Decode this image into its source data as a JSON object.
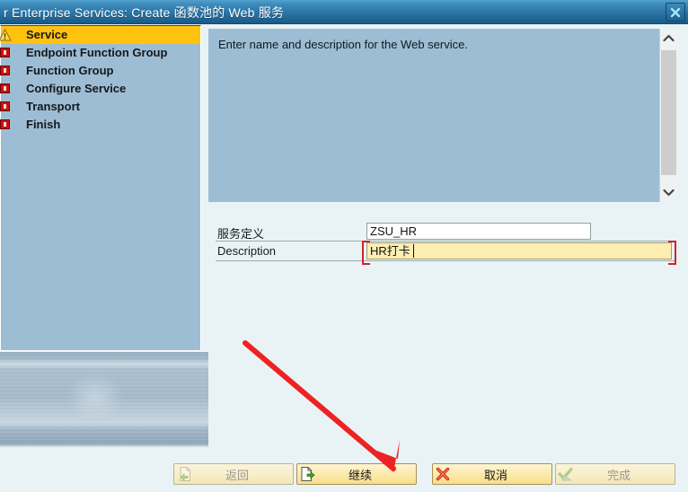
{
  "window": {
    "title": "r Enterprise Services: Create 函数池的 Web 服务",
    "close_icon": "close-icon",
    "titlebar_color": "#2b74a5"
  },
  "roadmap": {
    "steps": [
      {
        "label": "Service",
        "icon": "warning-triangle-icon",
        "selected": true
      },
      {
        "label": "Endpoint Function Group",
        "icon": "red-square-icon",
        "selected": false
      },
      {
        "label": "Function Group",
        "icon": "red-square-icon",
        "selected": false
      },
      {
        "label": "Configure Service",
        "icon": "red-square-icon",
        "selected": false
      },
      {
        "label": "Transport",
        "icon": "red-square-icon",
        "selected": false
      },
      {
        "label": "Finish",
        "icon": "red-square-icon",
        "selected": false
      }
    ],
    "selected_color": "#ffc20e",
    "panel_color": "#9dbdd4"
  },
  "instructions": {
    "text": "Enter name and description for the Web service.",
    "scrollbar": {
      "up_icon": "chevron-up-icon",
      "down_icon": "chevron-down-icon"
    }
  },
  "form": {
    "service_definition": {
      "label": "服务定义",
      "value": "ZSU_HR",
      "placeholder": ""
    },
    "description": {
      "label": "Description",
      "value": "HR打卡",
      "placeholder": "",
      "focused": true,
      "background": "#fdeeb2",
      "focus_marker_color": "#d2232a"
    }
  },
  "footer": {
    "buttons": [
      {
        "id": "back",
        "label": "返回",
        "icon": "page-back-arrow-icon",
        "enabled": false
      },
      {
        "id": "next",
        "label": "继续",
        "icon": "page-next-arrow-icon",
        "enabled": true
      },
      {
        "id": "cancel",
        "label": "取消",
        "icon": "red-x-icon",
        "enabled": true
      },
      {
        "id": "finish",
        "label": "完成",
        "icon": "check-pencil-icon",
        "enabled": false
      }
    ]
  },
  "annotation": {
    "type": "arrow",
    "color": "#ee2222",
    "points_to": "continue-button"
  }
}
